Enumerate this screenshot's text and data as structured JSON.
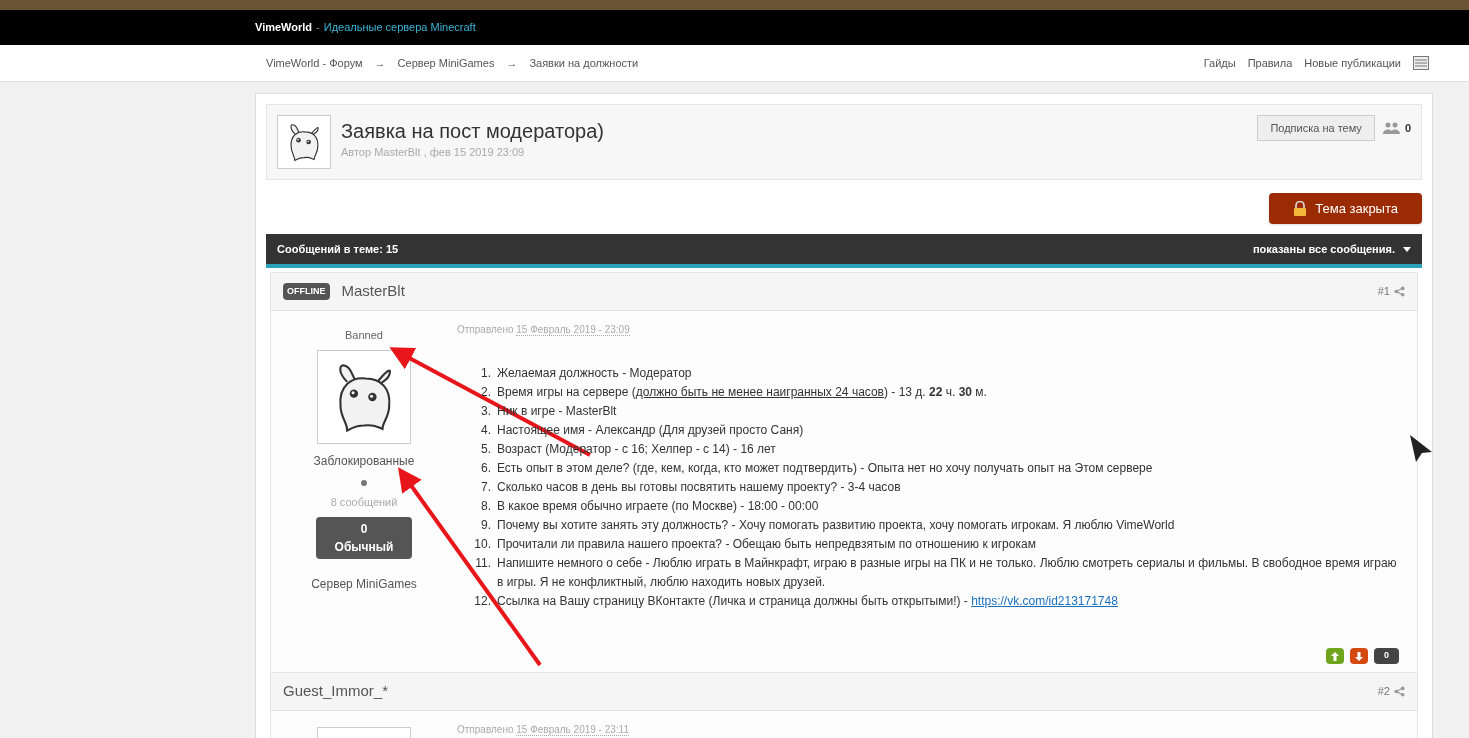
{
  "header": {
    "site": "VimeWorld",
    "separator": "-",
    "tagline": "Идеальные сервера Minecraft"
  },
  "breadcrumbs": [
    "VimeWorld - Форум",
    "Сервер MiniGames",
    "Заявки на должности"
  ],
  "breadcrumb_separator": "→",
  "nav_links": [
    "Гайды",
    "Правила",
    "Новые публикации"
  ],
  "topic": {
    "title": "Заявка на пост модератора)",
    "meta": "Автор MasterBlt , фев 15 2019 23:09",
    "subscribe_button": "Подписка на тему",
    "followers": "0",
    "closed_button": "Тема закрыта"
  },
  "stats_bar": {
    "count": "Сообщений в теме: 15",
    "filter": "показаны все сообщения."
  },
  "posts": [
    {
      "author": "MasterBlt",
      "status": "OFFLINE",
      "number": "#1",
      "group_title": "Banned",
      "group": "Заблокированные",
      "posts_count": "8 сообщений",
      "reputation": "0",
      "reputation_label": "Обычный",
      "server": "Сервер MiniGames",
      "sent_label": "Отправлено",
      "date": "15 Февраль 2019 - 23:09",
      "items": [
        {
          "number": "1.",
          "text": "Желаемая должность - Модератор"
        },
        {
          "number": "2.",
          "text": "Время игры на сервере (",
          "underlined": "должно быть не менее наигранных 24 часов",
          "after": ") - 13 д. **22** ч. **30** м."
        },
        {
          "number": "3.",
          "text": "Ник в игре - MasterBlt"
        },
        {
          "number": "4.",
          "text": "Настоящее имя - Александр (Для друзей просто Саня)"
        },
        {
          "number": "5.",
          "text": "Возраст  (Модератор - с 16; Хелпер - с 14) - 16 лет"
        },
        {
          "number": "6.",
          "text": "Есть опыт в этом деле? (где, кем, когда, кто может подтвердить) - Опыта нет но хочу получать опыт на Этом сервере"
        },
        {
          "number": "7.",
          "text": "Сколько часов в день вы готовы посвятить нашему проекту? - 3-4 часов"
        },
        {
          "number": "8.",
          "text": "В какое время обычно играете (по Москве) -  18:00 - 00:00"
        },
        {
          "number": "9.",
          "text": "Почему вы хотите занять эту должность? - Хочу помогать развитию проекта, хочу помогать игрокам. Я люблю VimeWorld"
        },
        {
          "number": "10.",
          "text": "Прочитали ли правила нашего проекта? - Обещаю быть непредвзятым по отношению к игрокам"
        },
        {
          "number": "11.",
          "text": "Напишите немного о себе - Люблю играть в Майнкрафт, играю в разные игры на ПК и не только. Люблю смотреть сериалы и фильмы. В свободное время играю в игры. Я не конфликтный, люблю находить новых друзей."
        },
        {
          "number": "12.",
          "text": "Ссылка на Вашу страницу ВКонтакте (Личка и страница должны быть открытыми!) - ",
          "link": "https://vk.com/id213171748"
        }
      ],
      "votes": "0"
    },
    {
      "author": "Guest_Immor_*",
      "number": "#2",
      "sent_label": "Отправлено",
      "date": "15 Февраль 2019 - 23:11"
    }
  ]
}
